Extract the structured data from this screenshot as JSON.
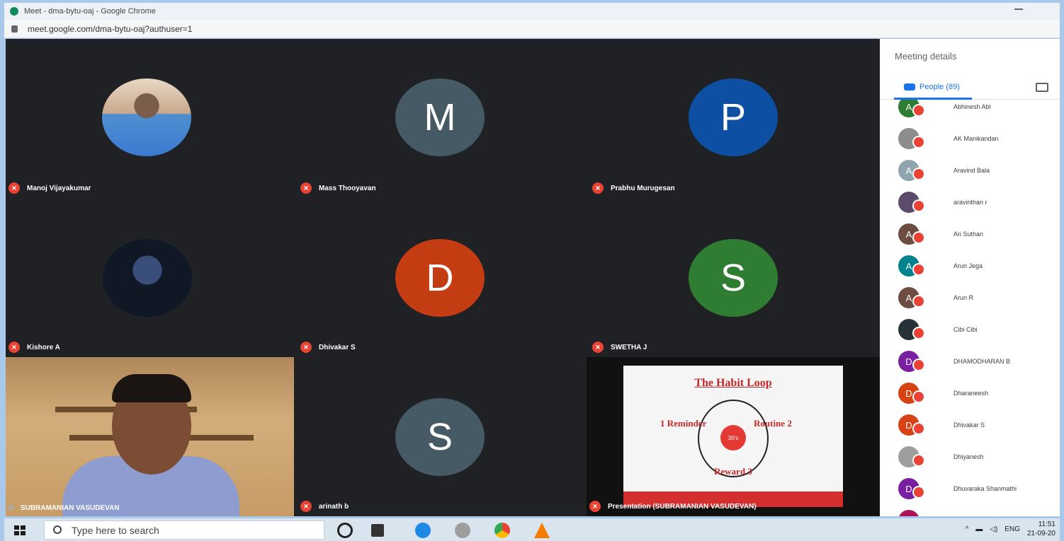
{
  "browser": {
    "window_title": "Meet - dma-bytu-oaj - Google Chrome",
    "url": "meet.google.com/dma-bytu-oaj?authuser=1"
  },
  "tiles": [
    {
      "name": "Manoj Vijayakumar",
      "avatar_letter": ""
    },
    {
      "name": "Mass Thooyavan",
      "avatar_letter": "M",
      "color": "#455a64"
    },
    {
      "name": "Prabhu Murugesan",
      "avatar_letter": "P",
      "color": "#0d4fa2"
    },
    {
      "name": "Kishore A",
      "avatar_letter": ""
    },
    {
      "name": "Dhivakar S",
      "avatar_letter": "D",
      "color": "#c33c12"
    },
    {
      "name": "SWETHA J",
      "avatar_letter": "S",
      "color": "#2e7d32"
    },
    {
      "name": "SUBRAMANIAN VASUDEVAN"
    },
    {
      "name": "arinath b",
      "avatar_letter": "S",
      "color": "#455a64"
    },
    {
      "name": "Presentation (SUBRAMANIAN VASUDEVAN)"
    }
  ],
  "slide": {
    "title": "The Habit Loop",
    "left_label": "Reminder",
    "right_label": "Routine",
    "bottom_label": "Reward",
    "left_num": "1",
    "right_num": "2",
    "bottom_num": "3",
    "center": "30's"
  },
  "panel": {
    "title": "Meeting details",
    "people_tab": "People (89)",
    "people": [
      {
        "name": "Abhinesh Abi",
        "initial": "A",
        "color": "#2e7d32"
      },
      {
        "name": "AK Manikandan",
        "initial": "",
        "color": "#8d8d8d"
      },
      {
        "name": "Aravind Bala",
        "initial": "A",
        "color": "#90a4ae"
      },
      {
        "name": "aravinthan r",
        "initial": "",
        "color": "#5c4b6b"
      },
      {
        "name": "Ari Suthan",
        "initial": "A",
        "color": "#6d4c41"
      },
      {
        "name": "Arun Jega",
        "initial": "A",
        "color": "#00838f"
      },
      {
        "name": "Arun R",
        "initial": "A",
        "color": "#6d4c41"
      },
      {
        "name": "Cibi Cibi",
        "initial": "",
        "color": "#263238"
      },
      {
        "name": "DHAMODHARAN B",
        "initial": "D",
        "color": "#7b1fa2"
      },
      {
        "name": "Dharaneesh",
        "initial": "D",
        "color": "#d84315"
      },
      {
        "name": "Dhivakar S",
        "initial": "D",
        "color": "#d84315"
      },
      {
        "name": "Dhiyanesh",
        "initial": "",
        "color": "#9e9e9e"
      },
      {
        "name": "Dhuvaraka Shanmathi",
        "initial": "D",
        "color": "#7b1fa2"
      },
      {
        "name": "",
        "initial": "",
        "color": "#ad1457"
      }
    ]
  },
  "taskbar": {
    "search_placeholder": "Type here to search",
    "lang": "ENG",
    "time": "11:51",
    "date": "21-09-20"
  }
}
